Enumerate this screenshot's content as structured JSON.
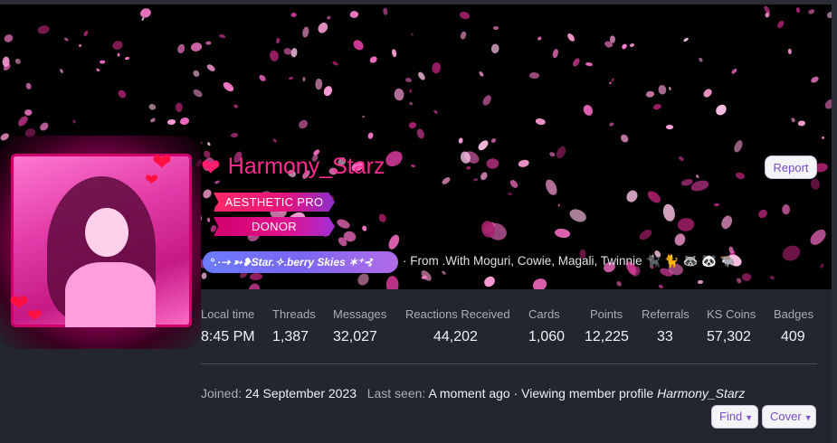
{
  "profile": {
    "username": "Harmony_Starz",
    "heart_icon": "heart-icon",
    "banners": [
      "AESTHETIC PRO",
      "DONOR"
    ],
    "title_pill": "°.·⇢ ➳❥Star.✧.berry Skies ✶⁺⊰",
    "from_text": "· From .With Moguri, Cowie, Magali, Twinnie 🐈‍⬛ 🐈 🦝 🐼 🐃",
    "report_label": "Report"
  },
  "stats": [
    {
      "label": "Local time",
      "value": "8:45 PM"
    },
    {
      "label": "Threads",
      "value": "1,387"
    },
    {
      "label": "Messages",
      "value": "32,027"
    },
    {
      "label": "Reactions Received",
      "value": "44,202"
    },
    {
      "label": "Cards",
      "value": "1,060"
    },
    {
      "label": "Points",
      "value": "12,225"
    },
    {
      "label": "Referrals",
      "value": "33"
    },
    {
      "label": "KS Coins",
      "value": "57,302"
    },
    {
      "label": "Badges",
      "value": "409"
    }
  ],
  "footer": {
    "joined_label": "Joined:",
    "joined_value": "24 September 2023",
    "last_seen_label": "Last seen:",
    "last_seen_value": "A moment ago",
    "activity_text": "· Viewing member profile",
    "activity_target": "Harmony_Starz"
  },
  "actions": {
    "find_label": "Find",
    "cover_label": "Cover"
  },
  "colors": {
    "accent_pink": "#ff2b8e",
    "button_text": "#7a4ec4",
    "background": "#23262d"
  }
}
